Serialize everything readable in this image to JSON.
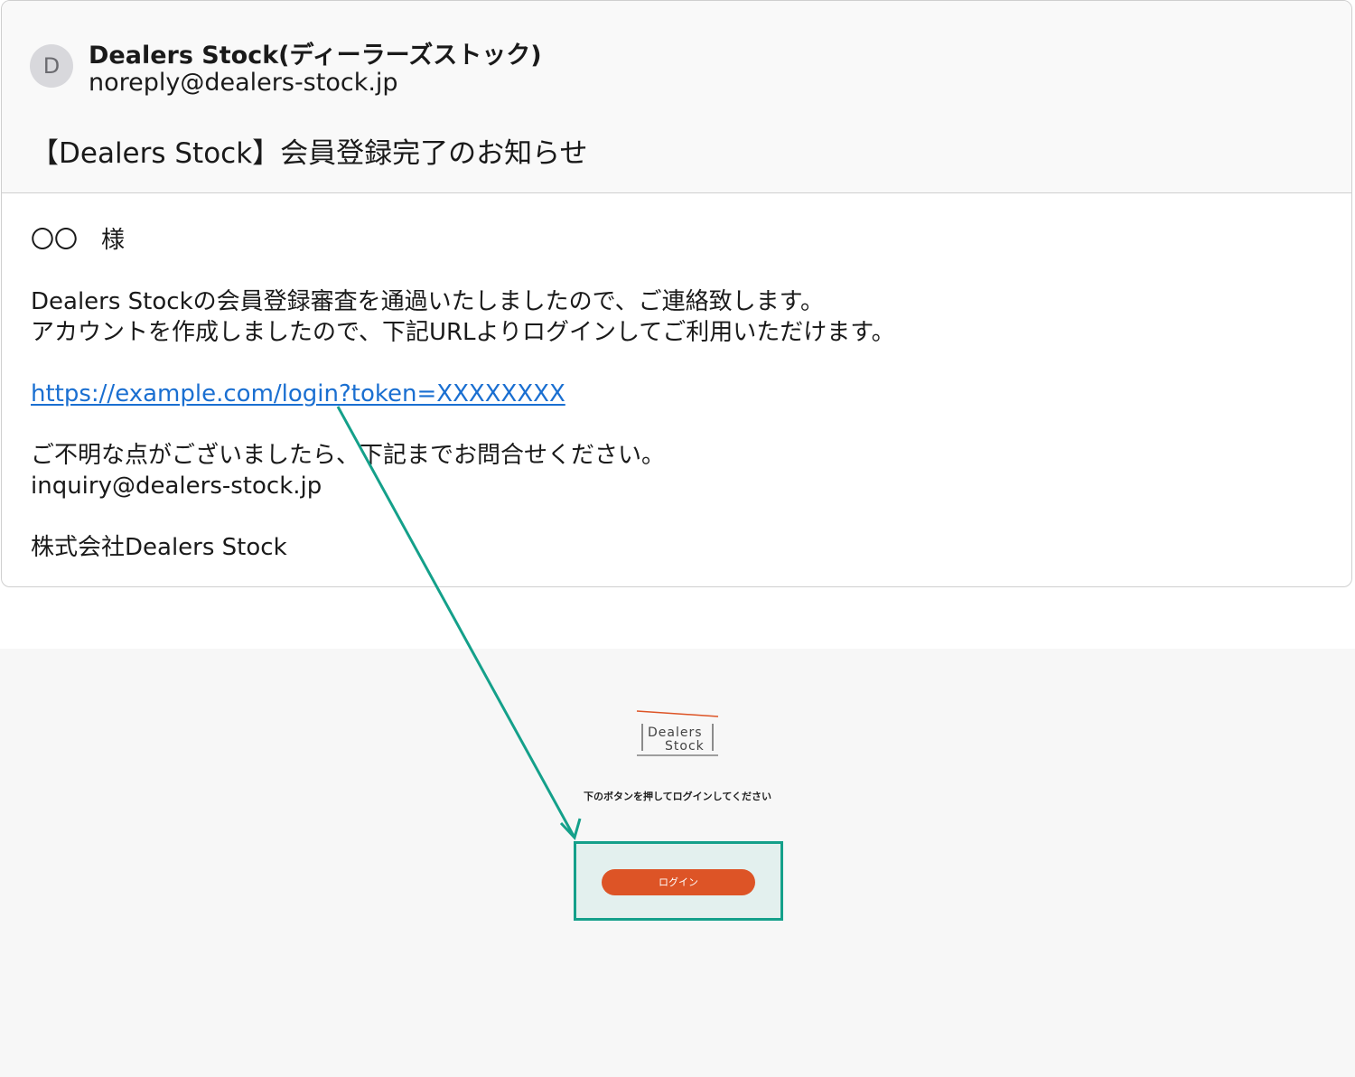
{
  "email": {
    "sender_initial": "D",
    "sender_name": "Dealers Stock(ディーラーズストック)",
    "sender_email": "noreply@dealers-stock.jp",
    "subject": "【Dealers Stock】会員登録完了のお知らせ",
    "body": {
      "salutation": "〇〇　様",
      "line1": "Dealers Stockの会員登録審査を通過いたしましたので、ご連絡致します。",
      "line2": "アカウントを作成しましたので、下記URLよりログインしてご利用いただけます。",
      "login_url": "https://example.com/login?token=XXXXXXXX",
      "inquiry_line": "ご不明な点がございましたら、下記までお問合せください。",
      "inquiry_email": "inquiry@dealers-stock.jp",
      "signature": "株式会社Dealers Stock"
    }
  },
  "login_page": {
    "logo_line1": "Dealers",
    "logo_line2": "Stock",
    "message": "下のボタンを押してログインしてください",
    "button_label": "ログイン"
  },
  "colors": {
    "link": "#1a6fd1",
    "accent_orange": "#dd5426",
    "highlight_teal": "#14a08a",
    "highlight_fill": "#e3f0ee"
  }
}
